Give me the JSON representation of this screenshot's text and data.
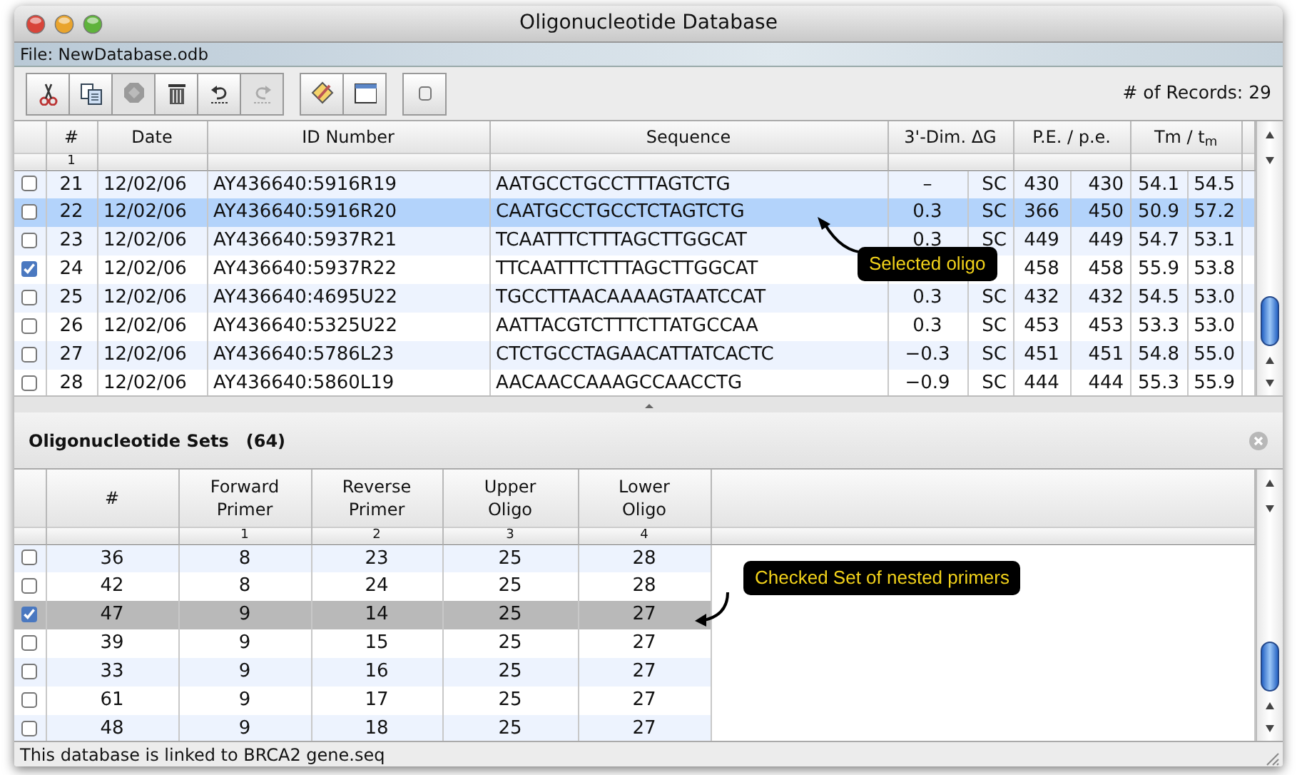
{
  "window": {
    "title": "Oligonucleotide Database"
  },
  "file_bar": {
    "text": "File: NewDatabase.odb"
  },
  "toolbar": {
    "groups": [
      [
        {
          "kind": "cut",
          "disabled": false
        },
        {
          "kind": "copy",
          "disabled": false
        },
        {
          "kind": "paste",
          "disabled": true
        },
        {
          "kind": "delete",
          "disabled": false
        },
        {
          "kind": "undo",
          "disabled": false
        },
        {
          "kind": "redo",
          "disabled": true
        }
      ],
      [
        {
          "kind": "edit",
          "disabled": false
        },
        {
          "kind": "window",
          "disabled": false
        }
      ],
      [
        {
          "kind": "toggle",
          "disabled": false
        }
      ]
    ],
    "record_count": "# of Records: 29"
  },
  "records": {
    "columns": [
      {
        "kind": "single",
        "label": "#",
        "sub": "1"
      },
      {
        "kind": "single",
        "label": "Date"
      },
      {
        "kind": "single",
        "label": "ID Number"
      },
      {
        "kind": "single",
        "label": "Sequence"
      },
      {
        "kind": "pair",
        "label": "3'-Dim. ΔG"
      },
      {
        "kind": "pair",
        "label": "P.E. / p.e."
      },
      {
        "kind": "pair",
        "label": "Tm / t$_{m}$"
      }
    ],
    "rows": [
      {
        "checked": false,
        "selected": false,
        "number": "21",
        "date": "12/02/06",
        "id": "AY436640:5916R19",
        "sequence": "AATGCCTGCCTTTAGTCTG",
        "dg": "–",
        "sc": "SC",
        "pe1": "430",
        "pe2": "430",
        "tm1": "54.1",
        "tm2": "54.5"
      },
      {
        "checked": false,
        "selected": true,
        "number": "22",
        "date": "12/02/06",
        "id": "AY436640:5916R20",
        "sequence": "CAATGCCTGCCTCTAGTCTG",
        "dg": "0.3",
        "sc": "SC",
        "pe1": "366",
        "pe2": "450",
        "tm1": "50.9",
        "tm2": "57.2"
      },
      {
        "checked": false,
        "selected": false,
        "number": "23",
        "date": "12/02/06",
        "id": "AY436640:5937R21",
        "sequence": "TCAATTTCTTTAGCTTGGCAT",
        "dg": "0.3",
        "sc": "SC",
        "pe1": "449",
        "pe2": "449",
        "tm1": "54.7",
        "tm2": "53.1"
      },
      {
        "checked": true,
        "selected": false,
        "number": "24",
        "date": "12/02/06",
        "id": "AY436640:5937R22",
        "sequence": "TTCAATTTCTTTAGCTTGGCAT",
        "pe1": "458",
        "pe2": "458",
        "tm1": "55.9",
        "tm2": "53.8"
      },
      {
        "checked": false,
        "selected": false,
        "number": "25",
        "date": "12/02/06",
        "id": "AY436640:4695U22",
        "sequence": "TGCCTTAACAAAAGTAATCCAT",
        "dg": "0.3",
        "sc": "SC",
        "pe1": "432",
        "pe2": "432",
        "tm1": "54.5",
        "tm2": "53.0"
      },
      {
        "checked": false,
        "selected": false,
        "number": "26",
        "date": "12/02/06",
        "id": "AY436640:5325U22",
        "sequence": "AATTACGTCTTTCTTATGCCAA",
        "dg": "0.3",
        "sc": "SC",
        "pe1": "453",
        "pe2": "453",
        "tm1": "53.3",
        "tm2": "53.0"
      },
      {
        "checked": false,
        "selected": false,
        "number": "27",
        "date": "12/02/06",
        "id": "AY436640:5786L23",
        "sequence": "CTCTGCCTAGAACATTATCACTC",
        "dg": "−0.3",
        "sc": "SC",
        "pe1": "451",
        "pe2": "451",
        "tm1": "54.8",
        "tm2": "55.0"
      },
      {
        "checked": false,
        "selected": false,
        "number": "28",
        "date": "12/02/06",
        "id": "AY436640:5860L19",
        "sequence": "AACAACCAAAGCCAACCTG",
        "dg": "−0.9",
        "sc": "SC",
        "pe1": "444",
        "pe2": "444",
        "tm1": "55.3",
        "tm2": "55.9"
      }
    ],
    "callout": "Selected oligo"
  },
  "sets": {
    "title": "Oligonucleotide Sets",
    "count": "(64)",
    "columns": [
      {
        "lines": [
          "#"
        ]
      },
      {
        "lines": [
          "Forward",
          "Primer"
        ],
        "sub": "1"
      },
      {
        "lines": [
          "Reverse",
          "Primer"
        ],
        "sub": "2"
      },
      {
        "lines": [
          "Upper",
          "Oligo"
        ],
        "sub": "3"
      },
      {
        "lines": [
          "Lower",
          "Oligo"
        ],
        "sub": "4"
      }
    ],
    "rows": [
      {
        "checked": false,
        "selected": false,
        "cells": [
          "36",
          "8",
          "23",
          "25",
          "28"
        ]
      },
      {
        "checked": false,
        "selected": false,
        "cells": [
          "42",
          "8",
          "24",
          "25",
          "28"
        ]
      },
      {
        "checked": true,
        "selected": true,
        "cells": [
          "47",
          "9",
          "14",
          "25",
          "27"
        ]
      },
      {
        "checked": false,
        "selected": false,
        "cells": [
          "39",
          "9",
          "15",
          "25",
          "27"
        ]
      },
      {
        "checked": false,
        "selected": false,
        "cells": [
          "33",
          "9",
          "16",
          "25",
          "27"
        ]
      },
      {
        "checked": false,
        "selected": false,
        "cells": [
          "61",
          "9",
          "17",
          "25",
          "27"
        ]
      },
      {
        "checked": false,
        "selected": false,
        "cells": [
          "48",
          "9",
          "18",
          "25",
          "27"
        ]
      }
    ],
    "callout": "Checked Set of nested primers"
  },
  "status_bar": "This database is linked to BRCA2 gene.seq"
}
